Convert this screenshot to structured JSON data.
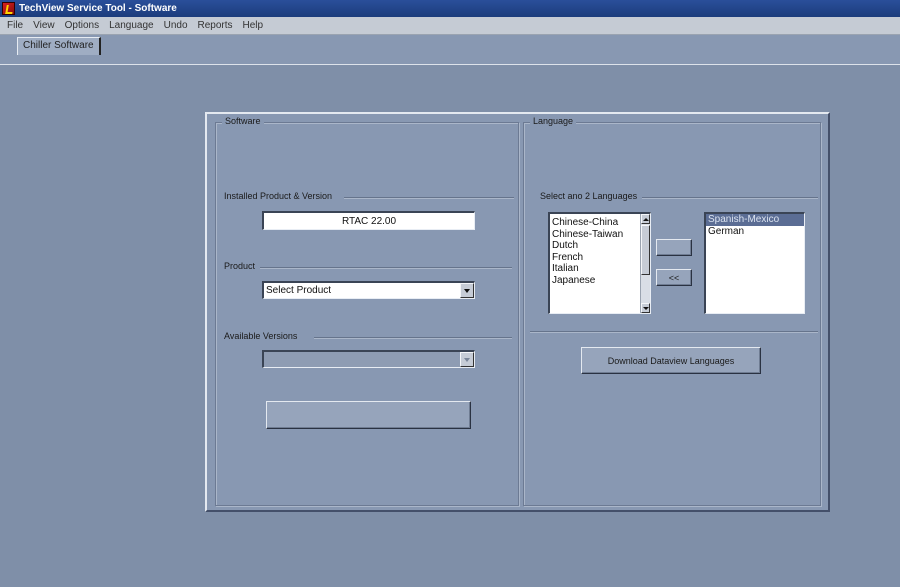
{
  "window": {
    "title": "TechView Service Tool - Software"
  },
  "menu": [
    "File",
    "View",
    "Options",
    "Language",
    "Undo",
    "Reports",
    "Help"
  ],
  "tabs": [
    {
      "label": "Chiller Software"
    }
  ],
  "software": {
    "title": "Software",
    "installed": {
      "label": "Installed Product & Version",
      "value": "RTAC 22.00"
    },
    "product": {
      "label": "Product",
      "value": "Select Product"
    },
    "versions": {
      "label": "Available Versions",
      "value": ""
    },
    "download_button": ""
  },
  "language": {
    "title": "Language",
    "select_label": "Select ano 2 Languages",
    "available": [
      "Chinese-China",
      "Chinese-Taiwan",
      "Dutch",
      "French",
      "Italian",
      "Japanese"
    ],
    "add_button": "",
    "remove_button": "<<",
    "selected": [
      "Spanish-Mexico",
      "German"
    ],
    "selected_index": 0,
    "download_button": "Download Dataview Languages"
  },
  "colors": {
    "title_bar": "#1c3c7c",
    "background": "#7f8fa8",
    "panel": "#8898b2",
    "selection": "#5b6d94"
  },
  "icons": {
    "app": "techview-app-icon",
    "dropdown": "chevron-down-icon",
    "scroll_up": "arrow-up-icon",
    "scroll_down": "arrow-down-icon"
  }
}
